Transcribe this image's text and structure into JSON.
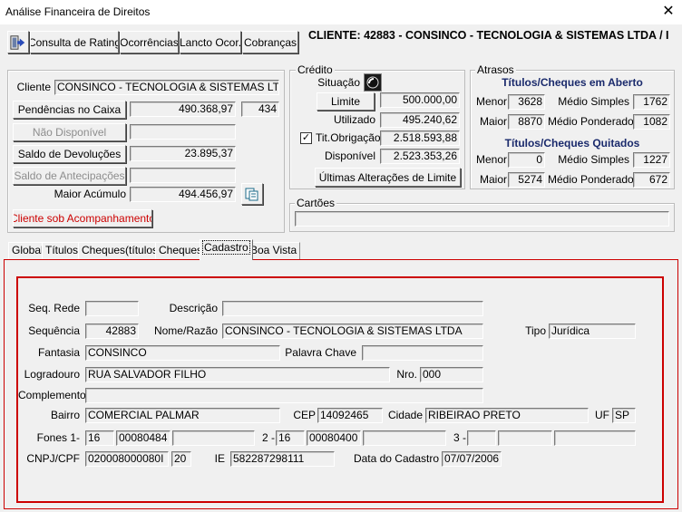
{
  "window": {
    "title": "Análise Financeira de Direitos",
    "close": "✕"
  },
  "toolbar": {
    "exit_icon": "exit-door-icon",
    "consulta_rating": "Consulta de Rating",
    "ocorrencias": "Ocorrências",
    "lancto_ocor": "Lancto Ocor.",
    "cobrancas": "Cobranças"
  },
  "header": {
    "cliente_text": "CLIENTE: 42883 - CONSINCO - TECNOLOGIA & SISTEMAS LTDA  /  I"
  },
  "left": {
    "cliente_label": "Cliente",
    "cliente_value": "CONSINCO - TECNOLOGIA & SISTEMAS LTDA",
    "pendencias_btn": "Pendências no Caixa",
    "pendencias_value": "490.368,97",
    "pendencias_count": "434",
    "nao_disponivel_btn": "Não Disponível",
    "nao_disponivel_value": "",
    "saldo_devolucoes_btn": "Saldo de Devoluções",
    "saldo_devolucoes_value": "23.895,37",
    "saldo_antecipacoes_btn": "Saldo de Antecipações",
    "saldo_antecipacoes_value": "",
    "maior_acumulo_label": "Maior Acúmulo",
    "maior_acumulo_value": "494.456,97",
    "acompanhamento_btn": "Cliente sob Acompanhamento"
  },
  "credito": {
    "caption": "Crédito",
    "situacao_label": "Situação",
    "limite_btn": "Limite",
    "limite_value": "500.000,00",
    "utilizado_label": "Utilizado",
    "utilizado_value": "495.240,62",
    "tit_obrigacao_label": "Tit.Obrigação",
    "tit_obrigacao_checked": "✓",
    "tit_obrigacao_value": "2.518.593,88",
    "disponivel_label": "Disponível",
    "disponivel_value": "2.523.353,26",
    "ultimas_btn": "Últimas Alterações de Limite"
  },
  "atrasos": {
    "caption": "Atrasos",
    "aberto_title": "Títulos/Cheques em Aberto",
    "quitados_title": "Títulos/Cheques Quitados",
    "menor_label": "Menor",
    "maior_label": "Maior",
    "medio_simples_label": "Médio Simples",
    "medio_ponderado_label": "Médio Ponderado",
    "aberto": {
      "menor": "3628",
      "maior": "8870",
      "medio_simples": "1762",
      "medio_ponderado": "1082"
    },
    "quitados": {
      "menor": "0",
      "maior": "5274",
      "medio_simples": "1227",
      "medio_ponderado": "672"
    }
  },
  "cartoes": {
    "caption": "Cartões",
    "value": ""
  },
  "tabs": {
    "global": "Global",
    "titulos": "Títulos",
    "cheques_titulos": "Cheques(títulos)",
    "cheques": "Cheques",
    "cadastro": "Cadastro",
    "boa_vista": "Boa Vista"
  },
  "cadastro": {
    "seq_rede_label": "Seq. Rede",
    "seq_rede": "",
    "descricao_label": "Descrição",
    "descricao": "",
    "sequencia_label": "Sequência",
    "sequencia": "42883",
    "nome_label": "Nome/Razão",
    "nome": "CONSINCO - TECNOLOGIA & SISTEMAS LTDA",
    "tipo_label": "Tipo",
    "tipo": "Jurídica",
    "fantasia_label": "Fantasia",
    "fantasia": "CONSINCO",
    "palavra_chave_label": "Palavra Chave",
    "palavra_chave": "",
    "logradouro_label": "Logradouro",
    "logradouro": "RUA SALVADOR FILHO",
    "nro_label": "Nro.",
    "nro": "000",
    "complemento_label": "Complemento",
    "complemento": "",
    "bairro_label": "Bairro",
    "bairro": "COMERCIAL PALMAR",
    "cep_label": "CEP",
    "cep": "14092465",
    "cidade_label": "Cidade",
    "cidade": "RIBEIRAO PRETO",
    "uf_label": "UF",
    "uf": "SP",
    "fones1_label": "Fones 1-",
    "fone1_ddd": "16",
    "fone1_num": "00080484",
    "fone1_ext": "",
    "fones2_label": "2 -",
    "fone2_ddd": "16",
    "fone2_num": "00080400",
    "fone2_ext": "",
    "fones3_label": "3 -",
    "fone3_ddd": "",
    "fone3_num": "",
    "fone3_ext": "",
    "cnpj_label": "CNPJ/CPF",
    "cnpj": "020008000080I",
    "cnpj_dv": "20",
    "ie_label": "IE",
    "ie": "582287298111",
    "data_cadastro_label": "Data do Cadastro",
    "data_cadastro": "07/07/2006"
  },
  "colors": {
    "accent_red": "#cc0000",
    "title_blue": "#1a2a6c"
  }
}
